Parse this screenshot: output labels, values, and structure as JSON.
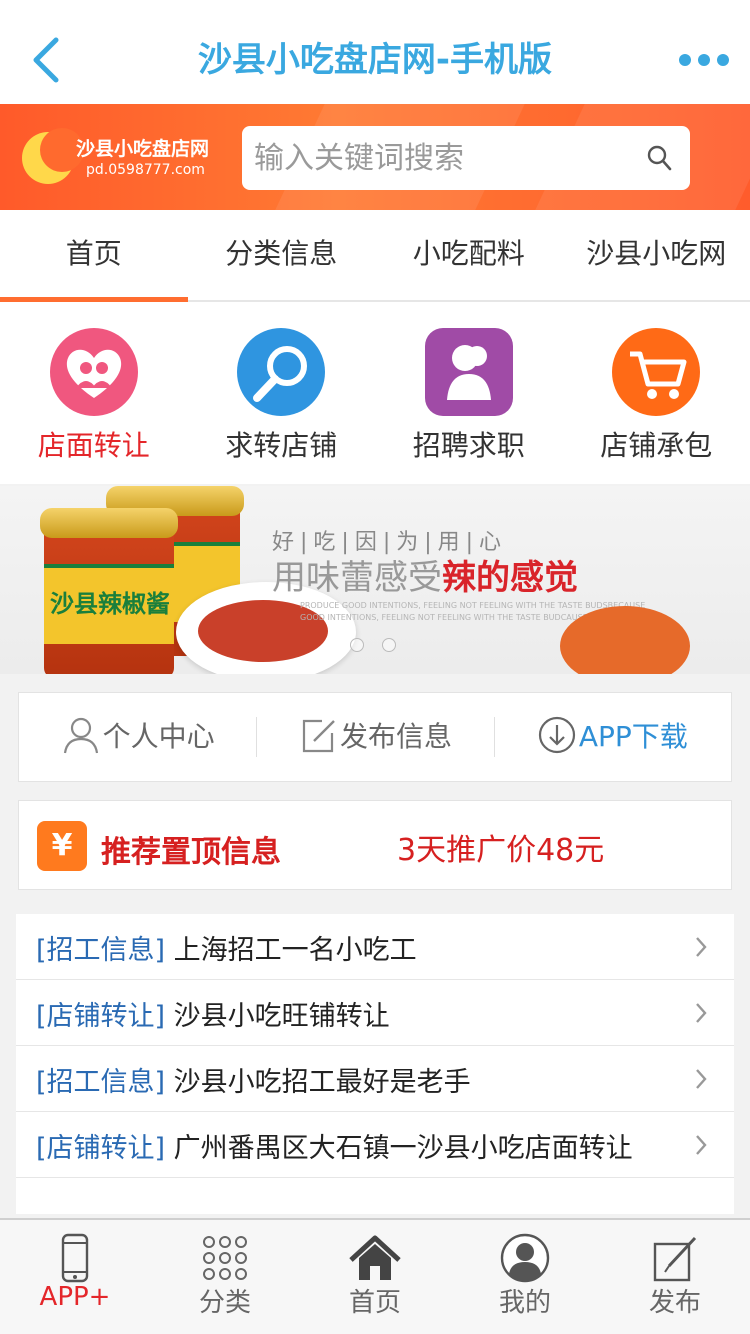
{
  "header": {
    "title": "沙县小吃盘店网-手机版",
    "back_icon": "chevron-left-icon",
    "more_icon": "more-dots-icon",
    "accent_color": "#3aa8e0"
  },
  "search": {
    "logo_name": "沙县小吃盘店网",
    "logo_url": "pd.0598777.com",
    "placeholder": "输入关键词搜索",
    "icon": "search-icon",
    "band_color": "#ff6a2e"
  },
  "tabs": [
    {
      "label": "首页",
      "active": true
    },
    {
      "label": "分类信息",
      "active": false
    },
    {
      "label": "小吃配料",
      "active": false
    },
    {
      "label": "沙县小吃网",
      "active": false
    }
  ],
  "quick_links": [
    {
      "label": "店面转让",
      "icon": "heart-people-icon",
      "color": "#f0577f"
    },
    {
      "label": "求转店铺",
      "icon": "magnifier-icon",
      "color": "#2f95e0"
    },
    {
      "label": "招聘求职",
      "icon": "person-icon",
      "color": "#a04ba6"
    },
    {
      "label": "店铺承包",
      "icon": "cart-icon",
      "color": "#ff6a16"
    }
  ],
  "promo": {
    "jar_label": "沙县辣椒酱",
    "line1": "好|吃|因|为|用|心",
    "line2_gray": "用味蕾感受",
    "line2_red": "辣的感觉",
    "english": "PRODUCE GOOD INTENTIONS, FEELING NOT FEELING WITH THE TASTE BUDSBECAUSE GOOD INTENTIONS, FEELING NOT FEELING WITH THE TASTE BUDCAUSE GOOD"
  },
  "actions": [
    {
      "label": "个人中心",
      "icon": "user-icon"
    },
    {
      "label": "发布信息",
      "icon": "edit-icon"
    },
    {
      "label": "APP下载",
      "icon": "download-icon"
    }
  ],
  "recommend": {
    "icon_text": "¥",
    "title": "推荐置顶信息",
    "price": "3天推广价48元"
  },
  "list": [
    {
      "tag": "[招工信息]",
      "text": "上海招工一名小吃工"
    },
    {
      "tag": "[店铺转让]",
      "text": "沙县小吃旺铺转让"
    },
    {
      "tag": "[招工信息]",
      "text": "沙县小吃招工最好是老手"
    },
    {
      "tag": "[店铺转让]",
      "text": "广州番禺区大石镇一沙县小吃店面转让"
    }
  ],
  "tabbar": [
    {
      "label": "APP+",
      "icon": "phone-icon",
      "active": true
    },
    {
      "label": "分类",
      "icon": "grid-dots-icon",
      "active": false
    },
    {
      "label": "首页",
      "icon": "home-icon",
      "active": false
    },
    {
      "label": "我的",
      "icon": "avatar-icon",
      "active": false
    },
    {
      "label": "发布",
      "icon": "compose-icon",
      "active": false
    }
  ]
}
